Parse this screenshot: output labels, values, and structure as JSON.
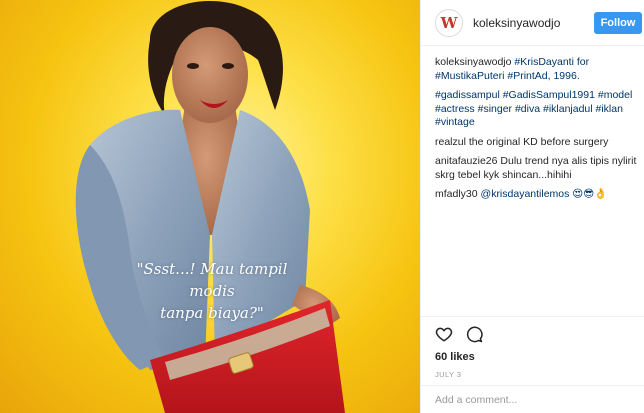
{
  "photo": {
    "alt": "Woman in denim shirt and red pants",
    "quote_line1": "\"Ssst...! Mau tampil modis",
    "quote_line2": "tanpa biaya?\""
  },
  "header": {
    "avatar_letter": "W",
    "username": "koleksinyawodjo",
    "follow_label": "Follow"
  },
  "caption": {
    "user": "koleksinyawodjo",
    "text1": "#KrisDayanti for",
    "text2": "#MustikaPuteri #PrintAd, 1996.",
    "hashtags1": "#gadissampul #GadisSampul1991 #model",
    "hashtags2": "#actress #singer #diva #iklanjadul #iklan",
    "hashtags3": "#vintage"
  },
  "comments": [
    {
      "user": "",
      "text": "realzul the original KD before surgery"
    },
    {
      "user": "anitafauzie26",
      "text": "Dulu trend nya alis tipis nylirit skrg tebel kyk shincan...hihihi"
    },
    {
      "user": "mfadly30",
      "text": "@krisdayantilemos 😍😎👌"
    }
  ],
  "actions": {
    "likes": "60 likes",
    "date": "JULY 3",
    "comment_placeholder": "Add a comment..."
  },
  "colors": {
    "accent": "#3897f0",
    "hashtag": "#003569",
    "border": "#efefef"
  }
}
